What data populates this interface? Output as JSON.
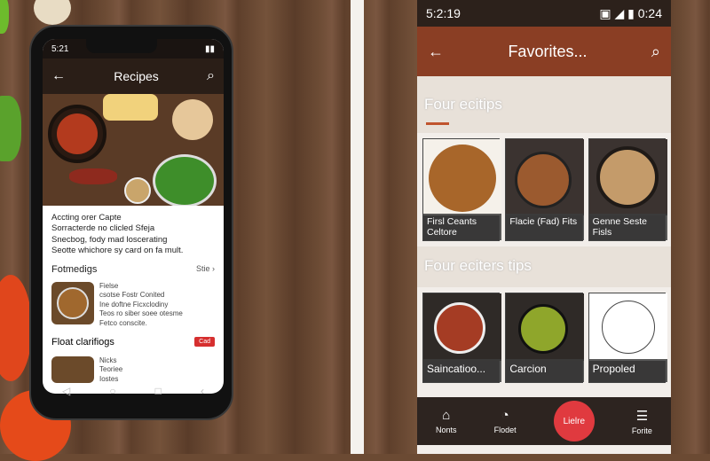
{
  "left_phone": {
    "status_time": "5:21",
    "title": "Recipes",
    "description_lines": [
      "Accting orer Capte",
      "Sorracterde no clicled Sfeja",
      "Snecbog, fody mad loscerating",
      "Seotte whichore sy card on fa mult."
    ],
    "section1": {
      "title": "Fotmedigs",
      "link": "Stie ›"
    },
    "list_item_text": [
      "Fielse",
      "csotse Fostr Conited",
      "Ine doftne Ficxclodiny",
      "Teos ro siber soee otesme",
      "Fetco conscite."
    ],
    "section2": {
      "title": "Float clarifiogs",
      "badge": "Cad"
    },
    "list_item2_text": [
      "Nicks",
      "Teoriee",
      "Iostes"
    ]
  },
  "right_phone": {
    "status_time": "5:2:19",
    "status_right": "0:24",
    "title": "Favorites...",
    "section1_title": "Four ecitips",
    "section2_title": "Four eciters tips",
    "row1": [
      {
        "label": "Firsl Ceants Celtore",
        "color": "#a8662a"
      },
      {
        "label": "Flacie (Fad) Fits",
        "color": "#9b5a2f"
      },
      {
        "label": "Genne Seste Fisls",
        "color": "#c49b6a"
      }
    ],
    "row2": [
      {
        "label": "Saincatioo...",
        "color": "#a53c24"
      },
      {
        "label": "Carcion",
        "color": "#8fa62b"
      },
      {
        "label": "Propoled",
        "color": "#ffffff"
      }
    ],
    "nav": [
      {
        "label": "Nonts",
        "icon": "home-icon"
      },
      {
        "label": "Flodet",
        "icon": "timer-icon"
      },
      {
        "label": "Lielre",
        "icon": "add-icon"
      },
      {
        "label": "Forite",
        "icon": "menu-icon"
      }
    ]
  }
}
